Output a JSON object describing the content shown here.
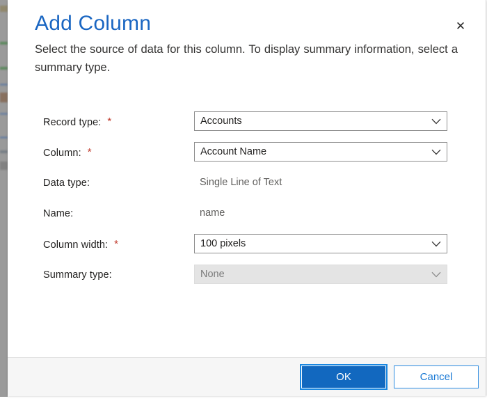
{
  "dialog": {
    "title": "Add Column",
    "description": "Select the source of data for this column. To display summary information, select a summary type.",
    "close_label": "✕"
  },
  "form": {
    "rows": [
      {
        "label": "Record type:",
        "required": true,
        "required_marker": "*",
        "control": "combo",
        "value": "Accounts",
        "disabled": false
      },
      {
        "label": "Column:",
        "required": true,
        "required_marker": "*",
        "control": "combo",
        "value": "Account Name",
        "disabled": false
      },
      {
        "label": "Data type:",
        "required": false,
        "required_marker": "",
        "control": "text",
        "value": "Single Line of Text",
        "disabled": false
      },
      {
        "label": "Name:",
        "required": false,
        "required_marker": "",
        "control": "text",
        "value": "name",
        "disabled": false
      },
      {
        "label": "Column width:",
        "required": true,
        "required_marker": "*",
        "control": "combo",
        "value": "100 pixels",
        "disabled": false
      },
      {
        "label": "Summary type:",
        "required": false,
        "required_marker": "",
        "control": "combo",
        "value": "None",
        "disabled": true
      }
    ]
  },
  "footer": {
    "ok_label": "OK",
    "cancel_label": "Cancel"
  },
  "colors": {
    "title_blue": "#1a66c2",
    "primary_button": "#1268bf",
    "link_blue": "#1878d4",
    "required_red": "#c0392b",
    "footer_bg": "#f6f6f6"
  }
}
